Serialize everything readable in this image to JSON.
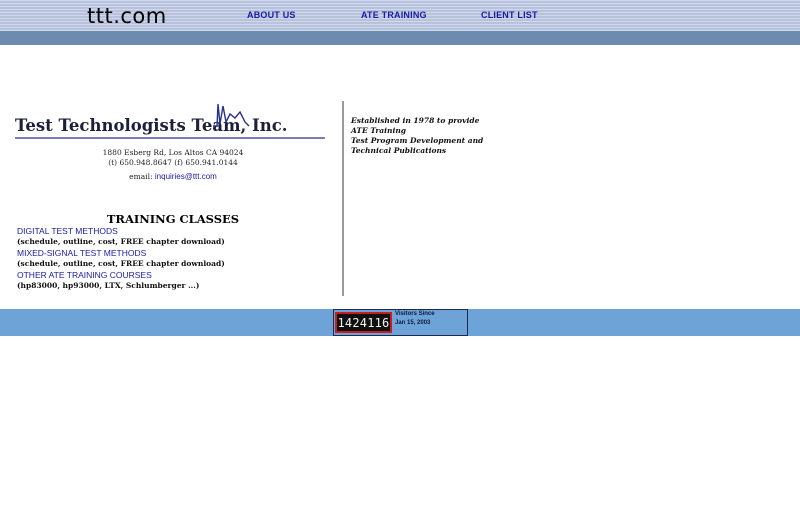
{
  "header": {
    "site_title": "ttt.com",
    "nav": [
      {
        "label": "ABOUT US"
      },
      {
        "label": "ATE TRAINING"
      },
      {
        "label": "CLIENT LIST"
      }
    ]
  },
  "company": {
    "logo_text": "Test Technologists Team, Inc.",
    "address": "1880 Esberg Rd, Los Altos CA 94024",
    "phones": "(t) 650.948.8647 (f) 650.941.0144",
    "email_label": "email:",
    "email": "inquiries@ttt.com"
  },
  "training": {
    "heading": "TRAINING CLASSES",
    "courses": [
      {
        "link": "DIGITAL TEST METHODS",
        "desc": "(schedule, outline, cost, FREE chapter download)"
      },
      {
        "link": "MIXED-SIGNAL TEST METHODS",
        "desc": "(schedule, outline, cost, FREE chapter download)"
      },
      {
        "link": "OTHER ATE TRAINING COURSES",
        "desc": "(hp83000, hp93000, LTX, Schlumberger ...)"
      }
    ]
  },
  "tagline": [
    "Established in 1978 to provide",
    "ATE Training",
    "Test Program Development and",
    "Technical Publications"
  ],
  "counter": {
    "count": "1424116",
    "label_line1": "Visitors Since",
    "label_line2": "Jan 15, 2003"
  },
  "colors": {
    "link": "#1a1aa6",
    "header_bg": "#b7c2dd",
    "stripe": "#6d8ab1",
    "footer_bg": "#6ea3d8"
  }
}
